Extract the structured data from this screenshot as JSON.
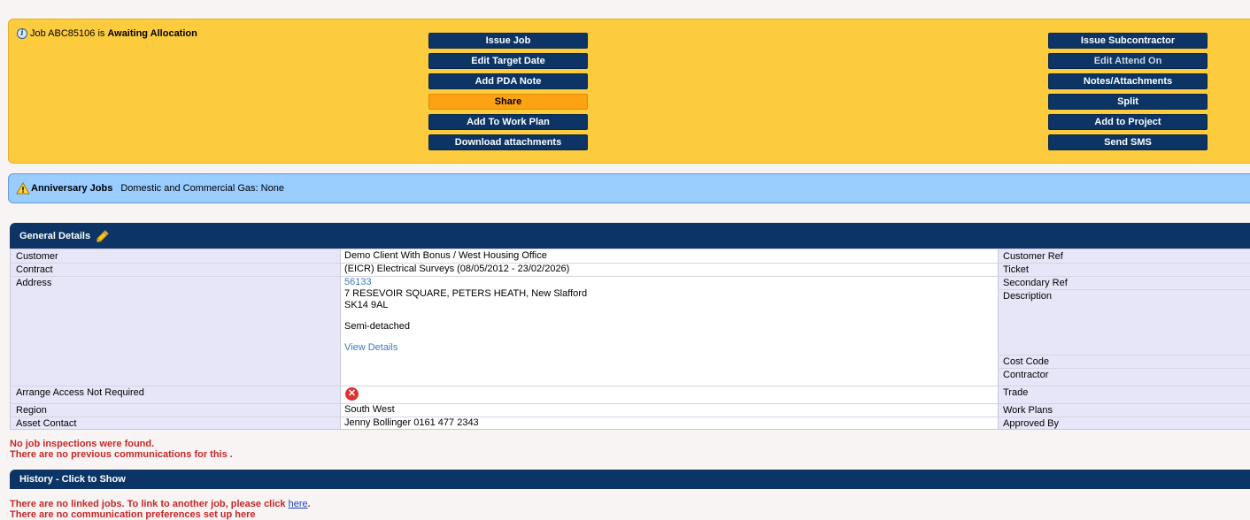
{
  "job_status": {
    "prefix": "Job ABC85106 is",
    "status": "Awaiting Allocation"
  },
  "actions_left": [
    "Issue Job",
    "Edit Target Date",
    "Add PDA Note",
    "Share",
    "Add To Work Plan",
    "Download attachments"
  ],
  "actions_right": [
    "Issue Subcontractor",
    "Edit Attend On",
    "Notes/Attachments",
    "Split",
    "Add to Project",
    "Send SMS"
  ],
  "anniversary": {
    "title": "Anniversary Jobs",
    "text": "Domestic and Commercial Gas: None"
  },
  "general_details": {
    "header": "General Details",
    "customer_label": "Customer",
    "customer_value": "Demo Client With Bonus / West Housing Office",
    "contract_label": "Contract",
    "contract_value": "(EICR) Electrical Surveys (08/05/2012 - 23/02/2026)",
    "address_label": "Address",
    "address_ref": "56133",
    "address_line1": "7 RESEVOIR SQUARE, PETERS HEATH, New Slafford",
    "address_postcode": "SK14 9AL",
    "address_type": "Semi-detached",
    "view_details": "View Details",
    "arrange_access_label": "Arrange Access Not Required",
    "region_label": "Region",
    "region_value": "South West",
    "asset_contact_label": "Asset Contact",
    "asset_contact_value": "Jenny Bollinger 0161 477 2343",
    "right_labels": {
      "customer_ref": "Customer Ref",
      "ticket": "Ticket",
      "secondary_ref": "Secondary Ref",
      "description": "Description",
      "cost_code": "Cost Code",
      "contractor": "Contractor",
      "trade": "Trade",
      "work_plans": "Work Plans",
      "approved_by": "Approved By"
    }
  },
  "messages": {
    "no_inspections": "No job inspections were found.",
    "no_previous_comms": "There are no previous communications for this ."
  },
  "history_header": "History - Click to Show",
  "linked_jobs": {
    "text": "There are no linked jobs. To link to another job, please click ",
    "link": "here",
    "suffix": "."
  },
  "comm_prefs": "There are no communication preferences set up here",
  "colors": {
    "status_panel": "#fdcc3e",
    "button": "#0c3566",
    "share_button": "#fca313",
    "info_panel": "#99ccff",
    "header": "#0c3566",
    "error_text": "#c62828"
  }
}
